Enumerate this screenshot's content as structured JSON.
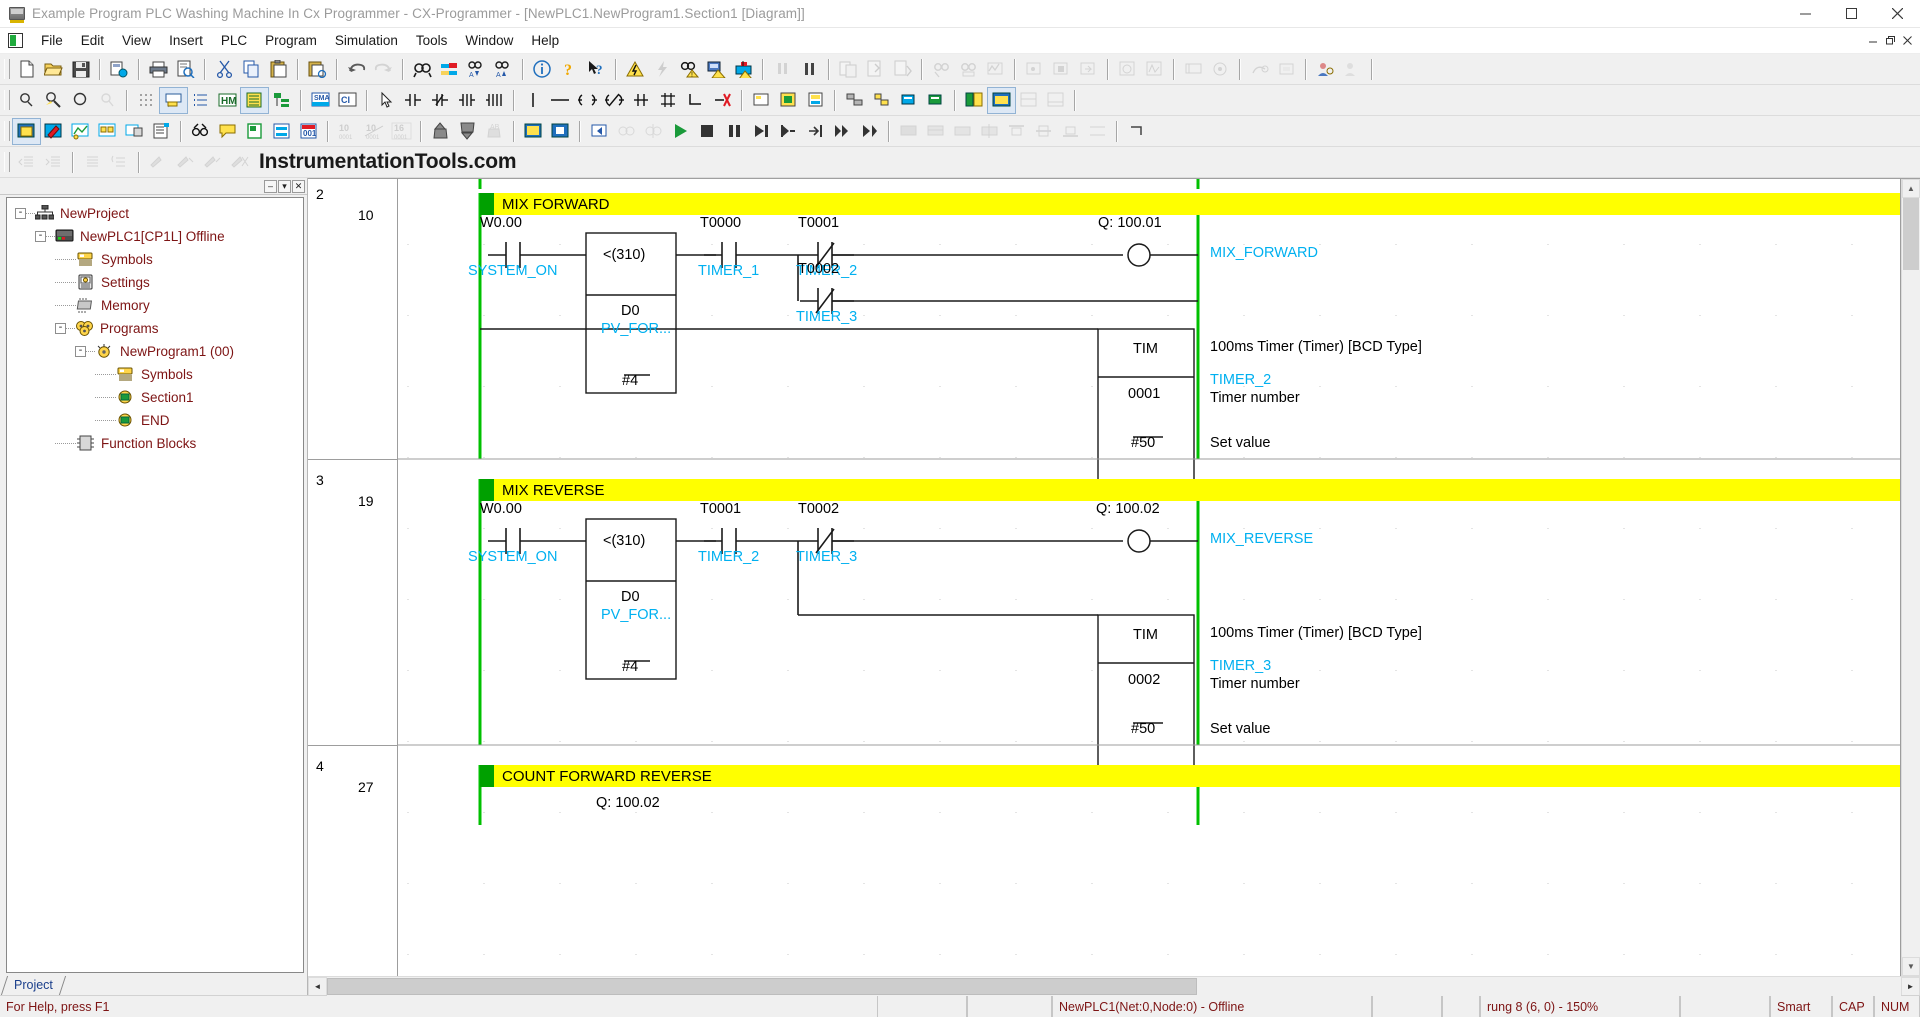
{
  "window": {
    "title": "Example Program PLC Washing Machine In Cx Programmer - CX-Programmer - [NewPLC1.NewProgram1.Section1 [Diagram]]",
    "minimize": "–",
    "maximize": "❐",
    "close": "✕",
    "doc_minimize": "–",
    "doc_restore": "❐",
    "doc_close": "✕"
  },
  "menu": {
    "items": [
      {
        "label": "File"
      },
      {
        "label": "Edit"
      },
      {
        "label": "View"
      },
      {
        "label": "Insert"
      },
      {
        "label": "PLC"
      },
      {
        "label": "Program"
      },
      {
        "label": "Simulation"
      },
      {
        "label": "Tools"
      },
      {
        "label": "Window"
      },
      {
        "label": "Help"
      }
    ]
  },
  "brand": {
    "text": "InstrumentationTools.com"
  },
  "toolbar": {
    "row1": [
      "new-icon",
      "open-icon",
      "save-icon",
      "sep",
      "save-to-memory-card-icon",
      "sep",
      "print-icon",
      "print-preview-icon",
      "sep",
      "cut-icon",
      "copy-icon",
      "paste-icon",
      "sep",
      "paste-special-icon",
      "sep",
      "undo-icon",
      "redo-icon",
      "sep",
      "find-icon",
      "replace-icon",
      "find-next-icon",
      "find-prev-icon",
      "sep",
      "info-icon",
      "help-icon",
      "help-pointer-icon",
      "sep",
      "work-online-icon",
      "auto-online-icon",
      "online-find-icon",
      "transfer-to-plc-icon",
      "transfer-from-plc-icon",
      "sep",
      "program-mode-icon",
      "run-mode-icon",
      "sep",
      "compare-icon",
      "compile-icon",
      "download-icon",
      "sep",
      "monitor-icon",
      "differential-monitor-icon",
      "data-trace-icon",
      "sep",
      "pause-icon",
      "step-run-icon",
      "step-in-icon",
      "sep",
      "clock-icon",
      "signal-icon",
      "sep",
      "plc-setup-icon",
      "io-table-icon"
    ],
    "row2": [
      "zoom-icon",
      "zoom-select-icon",
      "zoom-out-icon",
      "zoom-reset-icon",
      "sep",
      "grid-icon",
      "comment-icon",
      "list-icon",
      "address-icon",
      "memory-list-icon",
      "section-icon",
      "sep",
      "sma-table-icon",
      "ci-icon",
      "sep",
      "select-cursor-icon",
      "contact-no-icon",
      "contact-nc-icon",
      "contact-diff-up-icon",
      "contact-diff-down-icon",
      "sep",
      "vertical-line-icon",
      "horizontal-line-icon",
      "coil-icon",
      "coil-negated-icon",
      "coil-set-icon",
      "coil-reset-icon",
      "corner-icon",
      "delete-line-icon",
      "sep",
      "instruction-icon",
      "function-block-icon",
      "function-block-call-icon",
      "sep",
      "jump-icon",
      "jump-label-icon",
      "block-a-icon",
      "block-b-icon",
      "sep",
      "symbol-table-icon",
      "watch-window-icon",
      "cross-ref-icon",
      "output-window-icon"
    ],
    "row3": [
      "new-section-icon",
      "compile-program-icon",
      "online-edit-icon",
      "online-edit-transfer-icon",
      "online-edit-cancel-icon",
      "properties-icon",
      "sep",
      "differential-icon",
      "symbol-display-icon",
      "plc-memory-icon",
      "program-view-icon",
      "address-view-icon",
      "sep",
      "dec-display-icon",
      "dec10-display-icon",
      "hex-display-icon",
      "sep",
      "upload-block-icon",
      "download-block-icon",
      "compare-block-icon",
      "sep",
      "start-sim-icon",
      "stop-sim-icon",
      "sep",
      "scan-back-icon",
      "scan-fwd-icon",
      "run-icon",
      "stop-icon",
      "pause2-icon",
      "step-next-icon",
      "step-over-icon",
      "step-out-icon",
      "continuous-step-icon",
      "run-to-cursor-icon",
      "sep",
      "break-all-icon",
      "break-clear-icon",
      "break-set-icon",
      "break-toggle-icon",
      "align-top-icon",
      "align-mid-icon",
      "align-bot-icon",
      "align-dist-icon",
      "corner2-icon"
    ],
    "row4": [
      "indent-left-icon",
      "indent-right-icon",
      "sep",
      "list-view-icon",
      "outline-view-icon",
      "sep",
      "bookmark-icon",
      "bookmark-next-icon",
      "bookmark-prev-icon",
      "bookmark-clear-icon"
    ]
  },
  "tree": {
    "caption_buttons": [
      "–",
      "▾",
      "✕"
    ],
    "tab_label": "Project",
    "nodes": [
      {
        "label": "NewProject",
        "indent": 0,
        "expander": "-",
        "icon": "network-icon"
      },
      {
        "label": "NewPLC1[CP1L] Offline",
        "indent": 1,
        "expander": "-",
        "icon": "plc-icon"
      },
      {
        "label": "Symbols",
        "indent": 2,
        "expander": "",
        "icon": "symbols-icon"
      },
      {
        "label": "Settings",
        "indent": 2,
        "expander": "",
        "icon": "settings-icon"
      },
      {
        "label": "Memory",
        "indent": 2,
        "expander": "",
        "icon": "memory-icon"
      },
      {
        "label": "Programs",
        "indent": 2,
        "expander": "-",
        "icon": "programs-icon"
      },
      {
        "label": "NewProgram1 (00)",
        "indent": 3,
        "expander": "-",
        "icon": "program-icon"
      },
      {
        "label": "Symbols",
        "indent": 4,
        "expander": "",
        "icon": "symbols-icon"
      },
      {
        "label": "Section1",
        "indent": 4,
        "expander": "",
        "icon": "section-icon"
      },
      {
        "label": "END",
        "indent": 4,
        "expander": "",
        "icon": "section-icon"
      },
      {
        "label": "Function Blocks",
        "indent": 2,
        "expander": "",
        "icon": "fb-icon"
      }
    ]
  },
  "ladder": {
    "rungs": [
      {
        "number": "2",
        "step": "10",
        "comment": "MIX FORWARD",
        "contacts": [
          {
            "addr": "W0.00",
            "sym": "SYSTEM_ON",
            "type": "no"
          },
          {
            "addr": "T0000",
            "sym": "TIMER_1",
            "type": "no"
          },
          {
            "addr": "T0001",
            "sym": "TIMER_2",
            "type": "nc"
          },
          {
            "addr": "T0002",
            "sym": "TIMER_3",
            "type": "nc"
          }
        ],
        "compare": {
          "op": "<(310)",
          "operand1": "D0",
          "operand1_sym": "PV_FOR...",
          "operand2": "#4"
        },
        "coil": {
          "addr": "Q: 100.01",
          "sym": "MIX_FORWARD"
        },
        "timer": {
          "name": "TIM",
          "number": "0001",
          "setvalue": "#50",
          "note_type": "100ms Timer (Timer) [BCD Type]",
          "note_sym": "TIMER_2",
          "note_num_label": "Timer number",
          "note_sv_label": "Set value"
        }
      },
      {
        "number": "3",
        "step": "19",
        "comment": "MIX REVERSE",
        "contacts": [
          {
            "addr": "W0.00",
            "sym": "SYSTEM_ON",
            "type": "no"
          },
          {
            "addr": "T0001",
            "sym": "TIMER_2",
            "type": "no"
          },
          {
            "addr": "T0002",
            "sym": "TIMER_3",
            "type": "nc"
          }
        ],
        "compare": {
          "op": "<(310)",
          "operand1": "D0",
          "operand1_sym": "PV_FOR...",
          "operand2": "#4"
        },
        "coil": {
          "addr": "Q: 100.02",
          "sym": "MIX_REVERSE"
        },
        "timer": {
          "name": "TIM",
          "number": "0002",
          "setvalue": "#50",
          "note_type": "100ms Timer (Timer) [BCD Type]",
          "note_sym": "TIMER_3",
          "note_num_label": "Timer number",
          "note_sv_label": "Set value"
        }
      },
      {
        "number": "4",
        "step": "27",
        "comment": "COUNT FORWARD REVERSE",
        "partial_coil": "Q: 100.02"
      }
    ],
    "scroll": {
      "v_arrow_up": "▲",
      "v_arrow_down": "▼",
      "h_arrow_left": "◄",
      "h_arrow_right": "►"
    }
  },
  "statusbar": {
    "message": "For Help, press F1",
    "plc": "NewPLC1(Net:0,Node:0) - Offline",
    "position": "rung 8 (6, 0)  - 150%",
    "mode": "Smart",
    "caps": "CAP",
    "num": "NUM"
  },
  "colors": {
    "symbol_cyan": "#00b0f0",
    "comment_yellow": "#ffff00",
    "rail_green": "#00c000",
    "tree_text": "#7d1414",
    "status_text": "#7d1414"
  }
}
